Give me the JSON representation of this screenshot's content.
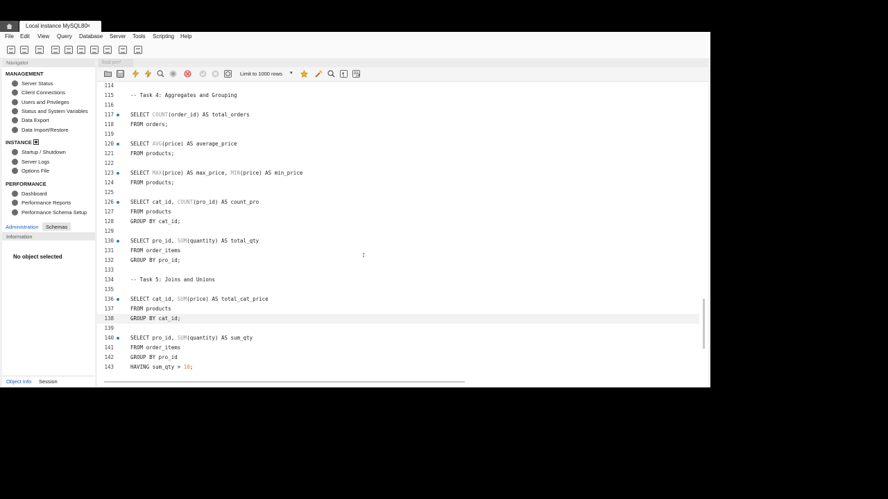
{
  "window": {
    "tab_title": "Local instance MySQL80",
    "tab_close": "×"
  },
  "menu": [
    "File",
    "Edit",
    "View",
    "Query",
    "Database",
    "Server",
    "Tools",
    "Scripting",
    "Help"
  ],
  "navigator": {
    "header": "Navigator",
    "management_title": "MANAGEMENT",
    "management": [
      "Server Status",
      "Client Connections",
      "Users and Privileges",
      "Status and System Variables",
      "Data Export",
      "Data Import/Restore"
    ],
    "instance_title": "INSTANCE",
    "instance": [
      "Startup / Shutdown",
      "Server Logs",
      "Options File"
    ],
    "performance_title": "PERFORMANCE",
    "performance": [
      "Dashboard",
      "Performance Reports",
      "Performance Schema Setup"
    ],
    "tabs": [
      "Administration",
      "Schemas"
    ],
    "info_header": "Information",
    "no_object": "No object selected",
    "bottom_tabs": [
      "Object Info",
      "Session"
    ]
  },
  "editor": {
    "doc_tab": "final pro*",
    "limit_label": "Limit to 1000 rows",
    "lines": [
      {
        "n": "114",
        "t": ""
      },
      {
        "n": "115",
        "t": "-- Task 4: Aggregates and Grouping",
        "kind": "comment"
      },
      {
        "n": "116",
        "t": ""
      },
      {
        "n": "117",
        "t": "SELECT COUNT(order_id) AS total_orders",
        "dot": true
      },
      {
        "n": "118",
        "t": "FROM orders;"
      },
      {
        "n": "119",
        "t": ""
      },
      {
        "n": "120",
        "t": "SELECT AVG(price) AS average_price",
        "dot": true
      },
      {
        "n": "121",
        "t": "FROM products;"
      },
      {
        "n": "122",
        "t": ""
      },
      {
        "n": "123",
        "t": "SELECT MAX(price) AS max_price, MIN(price) AS min_price",
        "dot": true
      },
      {
        "n": "124",
        "t": "FROM products;"
      },
      {
        "n": "125",
        "t": ""
      },
      {
        "n": "126",
        "t": "SELECT cat_id, COUNT(pro_id) AS count_pro",
        "dot": true
      },
      {
        "n": "127",
        "t": "FROM products"
      },
      {
        "n": "128",
        "t": "GROUP BY cat_id;"
      },
      {
        "n": "129",
        "t": ""
      },
      {
        "n": "130",
        "t": "SELECT pro_id, SUM(quantity) AS total_qty",
        "dot": true
      },
      {
        "n": "131",
        "t": "FROM order_items"
      },
      {
        "n": "132",
        "t": "GROUP BY pro_id;"
      },
      {
        "n": "133",
        "t": ""
      },
      {
        "n": "134",
        "t": "-- Task 5: Joins and Unions",
        "kind": "comment"
      },
      {
        "n": "135",
        "t": ""
      },
      {
        "n": "136",
        "t": "SELECT cat_id, SUM(price) AS total_cat_price",
        "dot": true
      },
      {
        "n": "137",
        "t": "FROM products"
      },
      {
        "n": "138",
        "t": "GROUP BY cat_id;",
        "current": true
      },
      {
        "n": "139",
        "t": ""
      },
      {
        "n": "140",
        "t": "SELECT pro_id, SUM(quantity) AS sum_qty",
        "dot": true
      },
      {
        "n": "141",
        "t": "FROM order_items"
      },
      {
        "n": "142",
        "t": "GROUP BY pro_id"
      },
      {
        "n": "143",
        "t": "HAVING sum_qty > 10;"
      }
    ]
  }
}
